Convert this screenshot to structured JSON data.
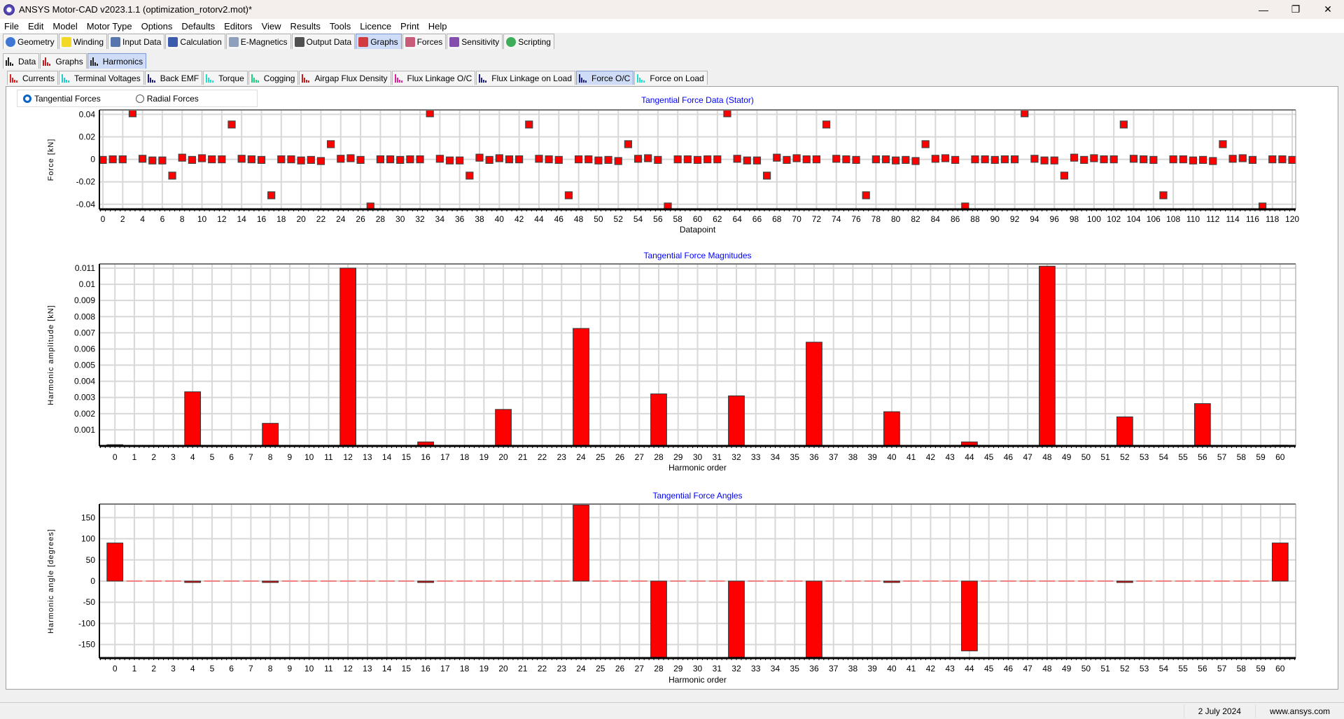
{
  "window": {
    "title": "ANSYS Motor-CAD v2023.1.1 (optimization_rotorv2.mot)*",
    "minimize": "—",
    "maximize": "❐",
    "close": "✕"
  },
  "menu": [
    "File",
    "Edit",
    "Model",
    "Motor Type",
    "Options",
    "Defaults",
    "Editors",
    "View",
    "Results",
    "Tools",
    "Licence",
    "Print",
    "Help"
  ],
  "main_tabs": [
    {
      "label": "Geometry",
      "icon": "geometry-icon",
      "color": "#1e5fd0"
    },
    {
      "label": "Winding",
      "icon": "winding-icon",
      "color": "#f2d200"
    },
    {
      "label": "Input Data",
      "icon": "input-data-icon",
      "color": "#3a5fa0"
    },
    {
      "label": "Calculation",
      "icon": "calculation-icon",
      "color": "#1a3fa0"
    },
    {
      "label": "E-Magnetics",
      "icon": "e-magnetics-icon",
      "color": "#7a8fb0"
    },
    {
      "label": "Output Data",
      "icon": "output-data-icon",
      "color": "#333333"
    },
    {
      "label": "Graphs",
      "icon": "graphs-icon",
      "color": "#d02020",
      "active": true
    },
    {
      "label": "Forces",
      "icon": "forces-icon",
      "color": "#c04060"
    },
    {
      "label": "Sensitivity",
      "icon": "sensitivity-icon",
      "color": "#7030a0"
    },
    {
      "label": "Scripting",
      "icon": "scripting-icon",
      "color": "#20a040"
    }
  ],
  "sub_tabs": [
    {
      "label": "Data",
      "icon": "data-grid-icon"
    },
    {
      "label": "Graphs",
      "icon": "graphs-icon"
    },
    {
      "label": "Harmonics",
      "icon": "harmonics-icon",
      "active": true
    }
  ],
  "harmonic_tabs": [
    {
      "label": "Currents",
      "color": "#e02020"
    },
    {
      "label": "Terminal Voltages",
      "color": "#20d0d0"
    },
    {
      "label": "Back EMF",
      "color": "#202080"
    },
    {
      "label": "Torque",
      "color": "#20e0d0"
    },
    {
      "label": "Cogging",
      "color": "#20d080"
    },
    {
      "label": "Airgap Flux Density",
      "color": "#c02020"
    },
    {
      "label": "Flux Linkage O/C",
      "color": "#e020a0"
    },
    {
      "label": "Flux Linkage on Load",
      "color": "#202080"
    },
    {
      "label": "Force O/C",
      "color": "#202080",
      "active": true
    },
    {
      "label": "Force on Load",
      "color": "#20e0d0"
    }
  ],
  "force_type": {
    "options": [
      "Tangential Forces",
      "Radial Forces"
    ],
    "selected": "Tangential Forces"
  },
  "status": {
    "date": "2 July 2024",
    "website": "www.ansys.com"
  },
  "chart_data": [
    {
      "type": "scatter",
      "title": "Tangential Force Data (Stator)",
      "xlabel": "Datapoint",
      "ylabel": "Force [kN]",
      "xlim": [
        -0.35,
        120.35
      ],
      "ylim": [
        -0.0445,
        0.044
      ],
      "grid": true,
      "xticks": [
        0,
        2,
        4,
        6,
        8,
        10,
        12,
        14,
        16,
        18,
        20,
        22,
        24,
        26,
        28,
        30,
        32,
        34,
        36,
        38,
        40,
        42,
        44,
        46,
        48,
        50,
        52,
        54,
        56,
        58,
        60,
        62,
        64,
        66,
        68,
        70,
        72,
        74,
        76,
        78,
        80,
        82,
        84,
        86,
        88,
        90,
        92,
        94,
        96,
        98,
        100,
        102,
        104,
        106,
        108,
        110,
        112,
        114,
        116,
        118,
        120
      ],
      "yticks": [
        0.04,
        0.02,
        0,
        -0.02,
        -0.04
      ],
      "ytick_labels": [
        "0.04",
        "0.02",
        "0",
        "-0.02",
        "-0.04"
      ],
      "marker_color": "#ff0000",
      "y": [
        -0.0005,
        0,
        0,
        0.041,
        0.0005,
        -0.001,
        -0.001,
        -0.0145,
        0.0015,
        -0.0005,
        0.001,
        0,
        0,
        0.031,
        0.0005,
        0,
        -0.0005,
        -0.032,
        0,
        0,
        -0.001,
        -0.0005,
        -0.0015,
        0.0135,
        0.0005,
        0.001,
        -0.0005,
        -0.042,
        0,
        0,
        -0.0005,
        0,
        0,
        0.041,
        0.0005,
        -0.001,
        -0.001,
        -0.0145,
        0.0015,
        -0.0005,
        0.001,
        0,
        0,
        0.031,
        0.0005,
        0,
        -0.0005,
        -0.032,
        0,
        0,
        -0.001,
        -0.0005,
        -0.0015,
        0.0135,
        0.0005,
        0.001,
        -0.0005,
        -0.042,
        0,
        0,
        -0.0005,
        0,
        0,
        0.041,
        0.0005,
        -0.001,
        -0.001,
        -0.0145,
        0.0015,
        -0.0005,
        0.001,
        0,
        0,
        0.031,
        0.0005,
        0,
        -0.0005,
        -0.032,
        0,
        0,
        -0.001,
        -0.0005,
        -0.0015,
        0.0135,
        0.0005,
        0.001,
        -0.0005,
        -0.042,
        0,
        0,
        -0.0005,
        0,
        0,
        0.041,
        0.0005,
        -0.001,
        -0.001,
        -0.0145,
        0.0015,
        -0.0005,
        0.001,
        0,
        0,
        0.031,
        0.0005,
        0,
        -0.0005,
        -0.032,
        0,
        0,
        -0.001,
        -0.0005,
        -0.0015,
        0.0135,
        0.0005,
        0.001,
        -0.0005,
        -0.042,
        0,
        0,
        -0.0005
      ]
    },
    {
      "type": "bar",
      "title": "Tangential Force Magnitudes",
      "xlabel": "Harmonic order",
      "ylabel": "Harmonic amplitude [kN]",
      "xlim": [
        -0.8,
        60.8
      ],
      "ylim": [
        0,
        0.01126
      ],
      "grid": true,
      "yticks": [
        0.011,
        0.01,
        0.009,
        0.008,
        0.007,
        0.006,
        0.005,
        0.004,
        0.003,
        0.002,
        0.001
      ],
      "ytick_labels": [
        "0.011",
        "0.01",
        "0.009",
        "0.008",
        "0.007",
        "0.006",
        "0.005",
        "0.004",
        "0.003",
        "0.002",
        "0.001"
      ],
      "bar_color": "#ff0000",
      "values": [
        8e-05,
        0,
        0,
        0,
        0.00335,
        0,
        0,
        0,
        0.0014,
        0,
        0,
        0,
        0.011,
        0,
        0,
        0,
        0.00025,
        0,
        0,
        0,
        0.00226,
        0,
        0,
        0,
        0.00727,
        0,
        0,
        0,
        0.00322,
        0,
        0,
        0,
        0.0031,
        0,
        0,
        0,
        0.00642,
        0,
        0,
        0,
        0.00212,
        0,
        0,
        0,
        0.00025,
        0,
        0,
        0,
        0.01112,
        0,
        0,
        0,
        0.0018,
        0,
        0,
        0,
        0.00262,
        0,
        0,
        0,
        5e-05
      ]
    },
    {
      "type": "bar",
      "title": "Tangential Force Angles",
      "xlabel": "Harmonic order",
      "ylabel": "Harmonic angle [degrees]",
      "xlim": [
        -0.8,
        60.8
      ],
      "ylim": [
        -182,
        182
      ],
      "grid": true,
      "yticks": [
        150,
        100,
        50,
        0,
        -50,
        -100,
        -150
      ],
      "ytick_labels": [
        "150",
        "100",
        "50",
        "0",
        "-50",
        "-100",
        "-150"
      ],
      "bar_color": "#ff0000",
      "values": [
        90,
        0,
        0,
        0,
        -2,
        0,
        0,
        0,
        -2,
        0,
        0,
        0,
        0,
        0,
        0,
        0,
        -2,
        0,
        0,
        0,
        0,
        0,
        0,
        0,
        180,
        0,
        0,
        0,
        -180,
        0,
        0,
        0,
        -180,
        0,
        0,
        0,
        -180,
        0,
        0,
        0,
        -2,
        0,
        0,
        0,
        -165,
        0,
        0,
        0,
        0,
        0,
        0,
        0,
        -2,
        0,
        0,
        0,
        0,
        0,
        0,
        0,
        90
      ]
    }
  ]
}
